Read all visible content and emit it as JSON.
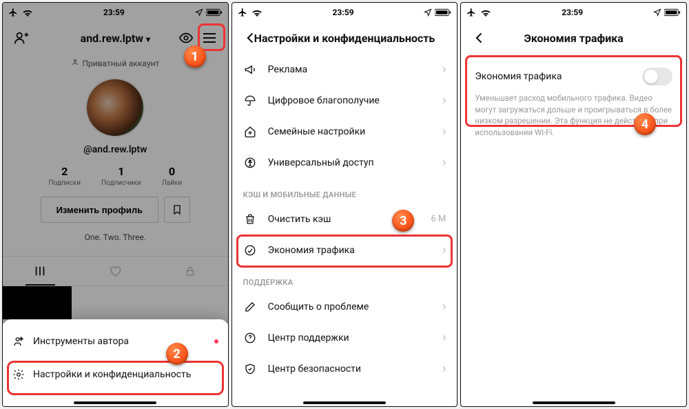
{
  "status": {
    "time": "23:59"
  },
  "screen1": {
    "username": "and.rew.lptw",
    "private_label": "Приватный аккаунт",
    "handle": "@and.rew.lptw",
    "stats": {
      "following": {
        "num": "2",
        "label": "Подписки"
      },
      "followers": {
        "num": "1",
        "label": "Подписчики"
      },
      "likes": {
        "num": "0",
        "label": "Лайки"
      }
    },
    "edit_btn": "Изменить профиль",
    "bio": "One. Two. Three.",
    "sheet": {
      "item1": "Инструменты автора",
      "item2": "Настройки и конфиденциальность"
    }
  },
  "screen2": {
    "title": "Настройки и конфиденциальность",
    "rows": {
      "ad": "Реклама",
      "digital": "Цифровое благополучие",
      "family": "Семейные настройки",
      "access": "Универсальный доступ"
    },
    "section1": "КЭШ И МОБИЛЬНЫЕ ДАННЫЕ",
    "cache": {
      "label": "Очистить кэш",
      "value": "6 M"
    },
    "saver": "Экономия трафика",
    "section2": "ПОДДЕРЖКА",
    "report": "Сообщить о проблеме",
    "support": "Центр поддержки",
    "safety": "Центр безопасности"
  },
  "screen3": {
    "title": "Экономия трафика",
    "toggle_label": "Экономия трафика",
    "desc": "Уменьшает расход мобильного трафика. Видео могут загружаться дольше и проигрываться в более низком разрешении. Эта функция не действует при использовании Wi-Fi."
  },
  "badges": {
    "b1": "1",
    "b2": "2",
    "b3": "3",
    "b4": "4"
  }
}
